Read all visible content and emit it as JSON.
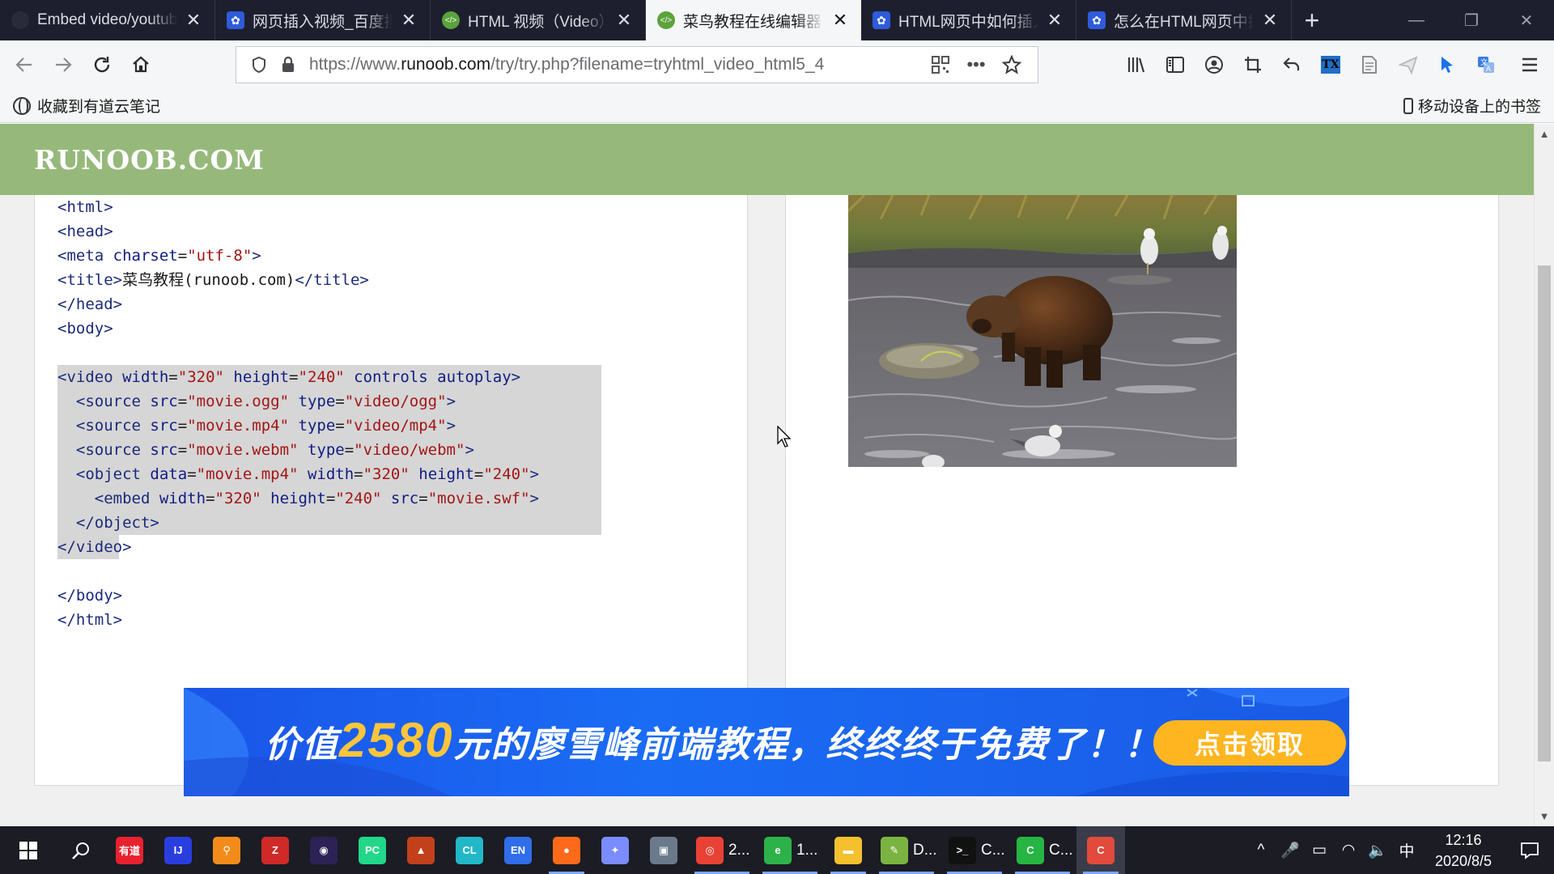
{
  "browser": {
    "tabs": [
      {
        "title": "Embed video/youtub",
        "icon": "youtube-icon",
        "active": false
      },
      {
        "title": "网页插入视频_百度搜索",
        "icon": "baidu-paw-icon",
        "active": false
      },
      {
        "title": "HTML 视频（Video）",
        "icon": "runoob-icon",
        "active": false
      },
      {
        "title": "菜鸟教程在线编辑器",
        "icon": "runoob-icon",
        "active": true
      },
      {
        "title": "HTML网页中如何插入",
        "icon": "baidu-paw-icon",
        "active": false
      },
      {
        "title": "怎么在HTML网页中插入",
        "icon": "baidu-paw-icon",
        "active": false
      }
    ],
    "new_tab": "+",
    "url_prefix": "https://www.",
    "url_domain": "runoob.com",
    "url_path": "/try/try.php?filename=tryhtml_video_html5_4",
    "bookmark_left": "收藏到有道云笔记",
    "bookmark_right": "移动设备上的书签"
  },
  "site": {
    "logo": "RUNOOB.COM"
  },
  "code_lines": [
    {
      "html": "<span class=\"t\">&lt;html&gt;</span>",
      "sel": false
    },
    {
      "html": "<span class=\"t\">&lt;head&gt;</span>",
      "sel": false
    },
    {
      "html": "<span class=\"t\">&lt;meta</span> <span class=\"a\">charset</span>=<span class=\"s\">\"utf-8\"</span><span class=\"t\">&gt;</span>",
      "sel": false
    },
    {
      "html": "<span class=\"t\">&lt;title&gt;</span><span class=\"p\">菜鸟教程(runoob.com)</span><span class=\"t\">&lt;/title&gt;</span>",
      "sel": false
    },
    {
      "html": "<span class=\"t\">&lt;/head&gt;</span>",
      "sel": false
    },
    {
      "html": "<span class=\"t\">&lt;body&gt;</span>",
      "sel": false
    },
    {
      "html": "",
      "sel": false
    },
    {
      "html": "<span class=\"t\">&lt;video</span> <span class=\"a\">width</span>=<span class=\"s\">\"320\"</span> <span class=\"a\">height</span>=<span class=\"s\">\"240\"</span> <span class=\"a\">controls</span> <span class=\"a\">autoplay</span><span class=\"t\">&gt;</span>",
      "sel": true
    },
    {
      "html": "  <span class=\"t\">&lt;source</span> <span class=\"a\">src</span>=<span class=\"s\">\"movie.ogg\"</span> <span class=\"a\">type</span>=<span class=\"s\">\"video/ogg\"</span><span class=\"t\">&gt;</span>",
      "sel": true
    },
    {
      "html": "  <span class=\"t\">&lt;source</span> <span class=\"a\">src</span>=<span class=\"s\">\"movie.mp4\"</span> <span class=\"a\">type</span>=<span class=\"s\">\"video/mp4\"</span><span class=\"t\">&gt;</span>",
      "sel": true
    },
    {
      "html": "  <span class=\"t\">&lt;source</span> <span class=\"a\">src</span>=<span class=\"s\">\"movie.webm\"</span> <span class=\"a\">type</span>=<span class=\"s\">\"video/webm\"</span><span class=\"t\">&gt;</span>",
      "sel": true
    },
    {
      "html": "  <span class=\"t\">&lt;object</span> <span class=\"a\">data</span>=<span class=\"s\">\"movie.mp4\"</span> <span class=\"a\">width</span>=<span class=\"s\">\"320\"</span> <span class=\"a\">height</span>=<span class=\"s\">\"240\"</span><span class=\"t\">&gt;</span>",
      "sel": true
    },
    {
      "html": "    <span class=\"t\">&lt;embed</span> <span class=\"a\">width</span>=<span class=\"s\">\"320\"</span> <span class=\"a\">height</span>=<span class=\"s\">\"240\"</span> <span class=\"a\">src</span>=<span class=\"s\">\"movie.swf\"</span><span class=\"t\">&gt;</span>",
      "sel": true
    },
    {
      "html": "  <span class=\"t\">&lt;/object&gt;</span>",
      "sel": true
    },
    {
      "html": "<span class=\"t\">&lt;/video&gt;</span>",
      "sel": "partial"
    },
    {
      "html": "",
      "sel": false
    },
    {
      "html": "<span class=\"t\">&lt;/body&gt;</span>",
      "sel": false
    },
    {
      "html": "<span class=\"t\">&lt;/html&gt;</span>",
      "sel": false
    }
  ],
  "banner": {
    "pre": "价值",
    "number": "2580",
    "post": "元的廖雪峰前端教程，终终终于免费了！！！",
    "cta": "点击领取"
  },
  "taskbar": {
    "apps": [
      {
        "name": "youdao-dict",
        "label": "有道",
        "color": "#e8212e",
        "text": "",
        "running": false
      },
      {
        "name": "intellij-idea",
        "label": "IJ",
        "color": "#2a3ee0",
        "text": "",
        "running": false
      },
      {
        "name": "everything-search",
        "label": "⚲",
        "color": "#f38b1a",
        "text": "",
        "running": false
      },
      {
        "name": "zotero",
        "label": "Z",
        "color": "#cf2a27",
        "text": "",
        "running": false
      },
      {
        "name": "eclipse",
        "label": "◉",
        "color": "#2c2255",
        "text": "",
        "running": false
      },
      {
        "name": "pycharm",
        "label": "PC",
        "color": "#21d789",
        "text": "",
        "running": false
      },
      {
        "name": "matlab",
        "label": "▲",
        "color": "#c2411b",
        "text": "",
        "running": false
      },
      {
        "name": "clion",
        "label": "CL",
        "color": "#22b8c8",
        "text": "",
        "running": false
      },
      {
        "name": "eudic",
        "label": "EN",
        "color": "#2f6ee8",
        "text": "",
        "running": false
      },
      {
        "name": "firefox",
        "label": "●",
        "color": "#ff6a1a",
        "text": "",
        "running": true
      },
      {
        "name": "mail-app",
        "label": "✦",
        "color": "#7a8cff",
        "text": "",
        "running": false
      },
      {
        "name": "image-viewer",
        "label": "▣",
        "color": "#6b7a8a",
        "text": "",
        "running": false
      },
      {
        "name": "chrome",
        "label": "◎",
        "color": "#e94235",
        "text": "2...",
        "running": true
      },
      {
        "name": "360-browser",
        "label": "e",
        "color": "#2db24a",
        "text": "1...",
        "running": true
      },
      {
        "name": "file-explorer",
        "label": "▬",
        "color": "#f4c02e",
        "text": "",
        "running": true
      },
      {
        "name": "notepad-plus",
        "label": "✎",
        "color": "#7bb342",
        "text": "D...",
        "running": true
      },
      {
        "name": "cmd",
        "label": ">_",
        "color": "#111111",
        "text": "C...",
        "running": true
      },
      {
        "name": "clion-project",
        "label": "C",
        "color": "#26b542",
        "text": "C...",
        "running": true
      },
      {
        "name": "codeblocks-app",
        "label": "C",
        "color": "#e24a3b",
        "text": "",
        "running": true
      }
    ],
    "tray_icons": [
      "^",
      "🎤",
      "▭",
      "◠",
      "🔈",
      "中"
    ],
    "time": "12:16",
    "date": "2020/8/5"
  }
}
